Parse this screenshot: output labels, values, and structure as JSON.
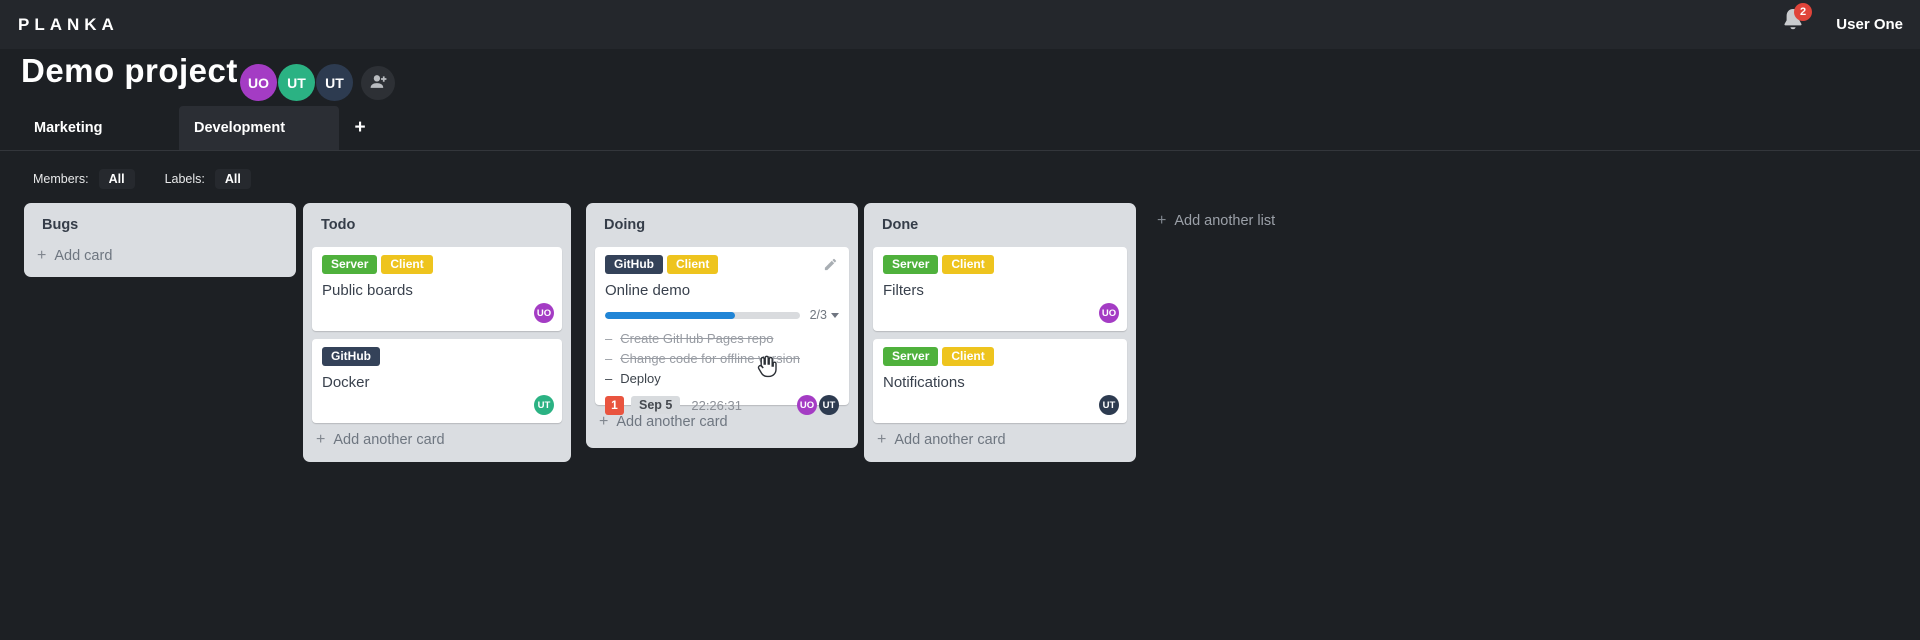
{
  "app": {
    "logo": "PLANKA",
    "notifications_count": "2",
    "user_name": "User One"
  },
  "project": {
    "title": "Demo project",
    "members": [
      {
        "initials": "UO",
        "color": "#a43cc4"
      },
      {
        "initials": "UT",
        "color": "#2bb283"
      },
      {
        "initials": "UT",
        "color": "#2d3b50"
      }
    ]
  },
  "tabs": {
    "items": [
      {
        "label": "Marketing"
      },
      {
        "label": "Development"
      }
    ],
    "add_label": "+"
  },
  "filters": {
    "members_label": "Members:",
    "members_value": "All",
    "labels_label": "Labels:",
    "labels_value": "All"
  },
  "icons": {
    "plus": "+",
    "dash": "–"
  },
  "colors": {
    "topbar_bg": "#24272c",
    "page_bg": "#1d2024",
    "list_bg": "#dadde1",
    "label_green": "#4fb13c",
    "label_yellow": "#eec41e",
    "label_navy": "#344259",
    "progress_blue": "#2085d6",
    "badge_red": "#e9543f",
    "avatar_purple": "#a43cc4",
    "avatar_teal": "#2bb283",
    "avatar_navy": "#2d3b50"
  },
  "board": {
    "add_list_label": "Add another list",
    "lists": [
      {
        "title": "Bugs",
        "add_label": "Add card",
        "cards": []
      },
      {
        "title": "Todo",
        "add_label": "Add another card",
        "cards": [
          {
            "title": "Public boards",
            "labels": [
              {
                "text": "Server",
                "color": "#4fb13c"
              },
              {
                "text": "Client",
                "color": "#eec41e"
              }
            ],
            "assignees": [
              {
                "initials": "UO",
                "color": "#a43cc4"
              }
            ]
          },
          {
            "title": "Docker",
            "labels": [
              {
                "text": "GitHub",
                "color": "#344259"
              }
            ],
            "assignees": [
              {
                "initials": "UT",
                "color": "#2bb283"
              }
            ]
          }
        ]
      },
      {
        "title": "Doing",
        "add_label": "Add another card",
        "cards": [
          {
            "title": "Online demo",
            "labels": [
              {
                "text": "GitHub",
                "color": "#344259"
              },
              {
                "text": "Client",
                "color": "#eec41e"
              }
            ],
            "checklist": {
              "completed": 2,
              "total": 3,
              "display": "2/3",
              "percent": 67
            },
            "tasks": [
              {
                "text": "Create GitHub Pages repo",
                "done": true
              },
              {
                "text": "Change code for offline version",
                "done": true
              },
              {
                "text": "Deploy",
                "done": false
              }
            ],
            "notification_count": "1",
            "due_date": "Sep 5",
            "timer": "22:26:31",
            "assignees": [
              {
                "initials": "UO",
                "color": "#a43cc4"
              },
              {
                "initials": "UT",
                "color": "#2d3b50"
              }
            ]
          }
        ]
      },
      {
        "title": "Done",
        "add_label": "Add another card",
        "cards": [
          {
            "title": "Filters",
            "labels": [
              {
                "text": "Server",
                "color": "#4fb13c"
              },
              {
                "text": "Client",
                "color": "#eec41e"
              }
            ],
            "assignees": [
              {
                "initials": "UO",
                "color": "#a43cc4"
              }
            ]
          },
          {
            "title": "Notifications",
            "labels": [
              {
                "text": "Server",
                "color": "#4fb13c"
              },
              {
                "text": "Client",
                "color": "#eec41e"
              }
            ],
            "assignees": [
              {
                "initials": "UT",
                "color": "#2d3b50"
              }
            ]
          }
        ]
      }
    ]
  }
}
